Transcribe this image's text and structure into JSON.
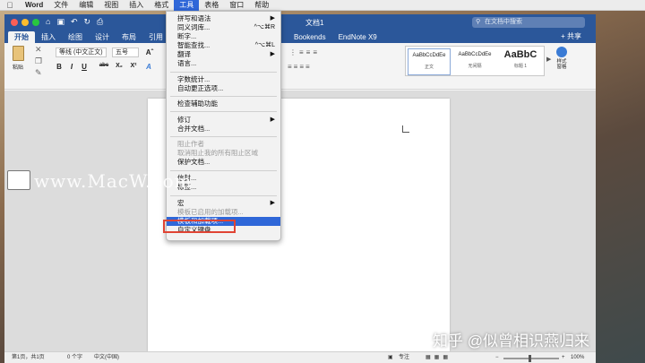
{
  "menubar": {
    "app_name": "Word",
    "items": [
      "文件",
      "编辑",
      "视图",
      "插入",
      "格式",
      "工具",
      "表格",
      "窗口",
      "帮助"
    ],
    "active_item": "工具"
  },
  "window": {
    "doc_title": "文档1",
    "search_placeholder": "在文档中搜索",
    "share_label": "共享"
  },
  "ribbon": {
    "tabs": [
      "开始",
      "插入",
      "绘图",
      "设计",
      "布局",
      "引用",
      "Bookends",
      "EndNote X9"
    ],
    "active_tab": "开始",
    "paste_label": "粘贴",
    "font_name": "等线 (中文正文)",
    "font_size": "五号",
    "styles": [
      {
        "sample": "AaBbCcDdEe",
        "name": "正文"
      },
      {
        "sample": "AaBbCcDdEe",
        "name": "无间隔"
      },
      {
        "sample": "AaBbC",
        "name": "标题 1"
      }
    ],
    "styles_pane_label": "样式\n窗格"
  },
  "tools_menu": {
    "items": [
      {
        "label": "拼写和语法",
        "shortcut": "▶",
        "disabled": false
      },
      {
        "label": "同义词库...",
        "shortcut": "^⌥⌘R",
        "disabled": false
      },
      {
        "label": "断字...",
        "shortcut": "",
        "disabled": false
      },
      {
        "label": "智能查找...",
        "shortcut": "^⌥⌘L",
        "disabled": false
      },
      {
        "label": "翻译",
        "shortcut": "▶",
        "disabled": false
      },
      {
        "label": "语言...",
        "shortcut": "",
        "disabled": false
      },
      {
        "label": "字数统计...",
        "shortcut": "",
        "disabled": false
      },
      {
        "label": "自动更正选项...",
        "shortcut": "",
        "disabled": false
      },
      {
        "label": "检查辅助功能",
        "shortcut": "",
        "disabled": false
      },
      {
        "label": "修订",
        "shortcut": "▶",
        "disabled": false
      },
      {
        "label": "合并文档...",
        "shortcut": "",
        "disabled": false
      },
      {
        "label": "阻止作者",
        "shortcut": "",
        "disabled": true
      },
      {
        "label": "取消阻止我的所有阻止区域",
        "shortcut": "",
        "disabled": true
      },
      {
        "label": "保护文档...",
        "shortcut": "",
        "disabled": false
      },
      {
        "label": "信封...",
        "shortcut": "",
        "disabled": false
      },
      {
        "label": "标签...",
        "shortcut": "",
        "disabled": false
      },
      {
        "label": "宏",
        "shortcut": "▶",
        "disabled": false
      },
      {
        "label": "模板已启用的加载项...",
        "shortcut": "",
        "disabled": true
      },
      {
        "label": "模板和加载项...",
        "shortcut": "",
        "disabled": false,
        "highlighted": true
      },
      {
        "label": "自定义键盘...",
        "shortcut": "",
        "disabled": false
      }
    ]
  },
  "statusbar": {
    "page": "第1页，共1页",
    "words": "0 个字",
    "language": "中文(中国)",
    "focus": "专注",
    "zoom": "100%"
  },
  "watermarks": {
    "site": "www.MacW.com",
    "zhihu": "知乎 @似曾相识燕归来"
  }
}
